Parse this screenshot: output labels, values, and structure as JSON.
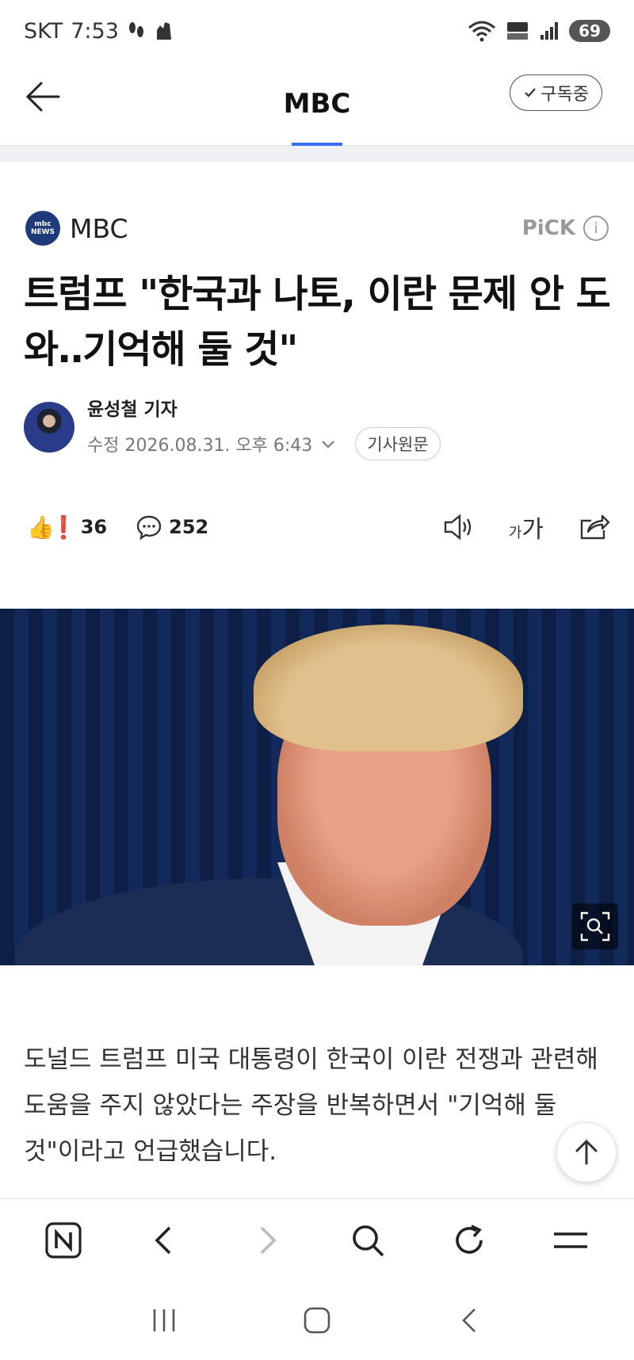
{
  "status": {
    "carrier": "SKT",
    "time": "7:53",
    "battery": "69",
    "icons": [
      "footprint-icon",
      "glove-icon",
      "wifi-icon",
      "hd-voice-icon",
      "signal-icon",
      "battery-icon"
    ]
  },
  "nav": {
    "title": "MBC",
    "subscribe_label": "구독중"
  },
  "press": {
    "logo_text_top": "mbc",
    "logo_text_bottom": "NEWS",
    "name": "MBC",
    "pick_label": "PiCK",
    "brand_color": "#1e3a7a"
  },
  "article": {
    "headline": "트럼프 \"한국과 나토, 이란 문제 안 도와‥기억해 둘 것\"",
    "reporter": "윤성철 기자",
    "date": "수정 2026.08.31. 오후 6:43",
    "original_button": "기사원문",
    "body": "도널드 트럼프 미국 대통령이 한국이 이란 전쟁과 관련해 도움을 주지 않았다는 주장을 반복하면서 \"기억해 둘 것\"이라고 언급했습니다."
  },
  "actions": {
    "reaction_count": "36",
    "comment_count": "252",
    "font_small": "가",
    "font_large": "가"
  },
  "colors": {
    "accent": "#3b6cf2",
    "text": "#111111",
    "muted": "#777777"
  }
}
